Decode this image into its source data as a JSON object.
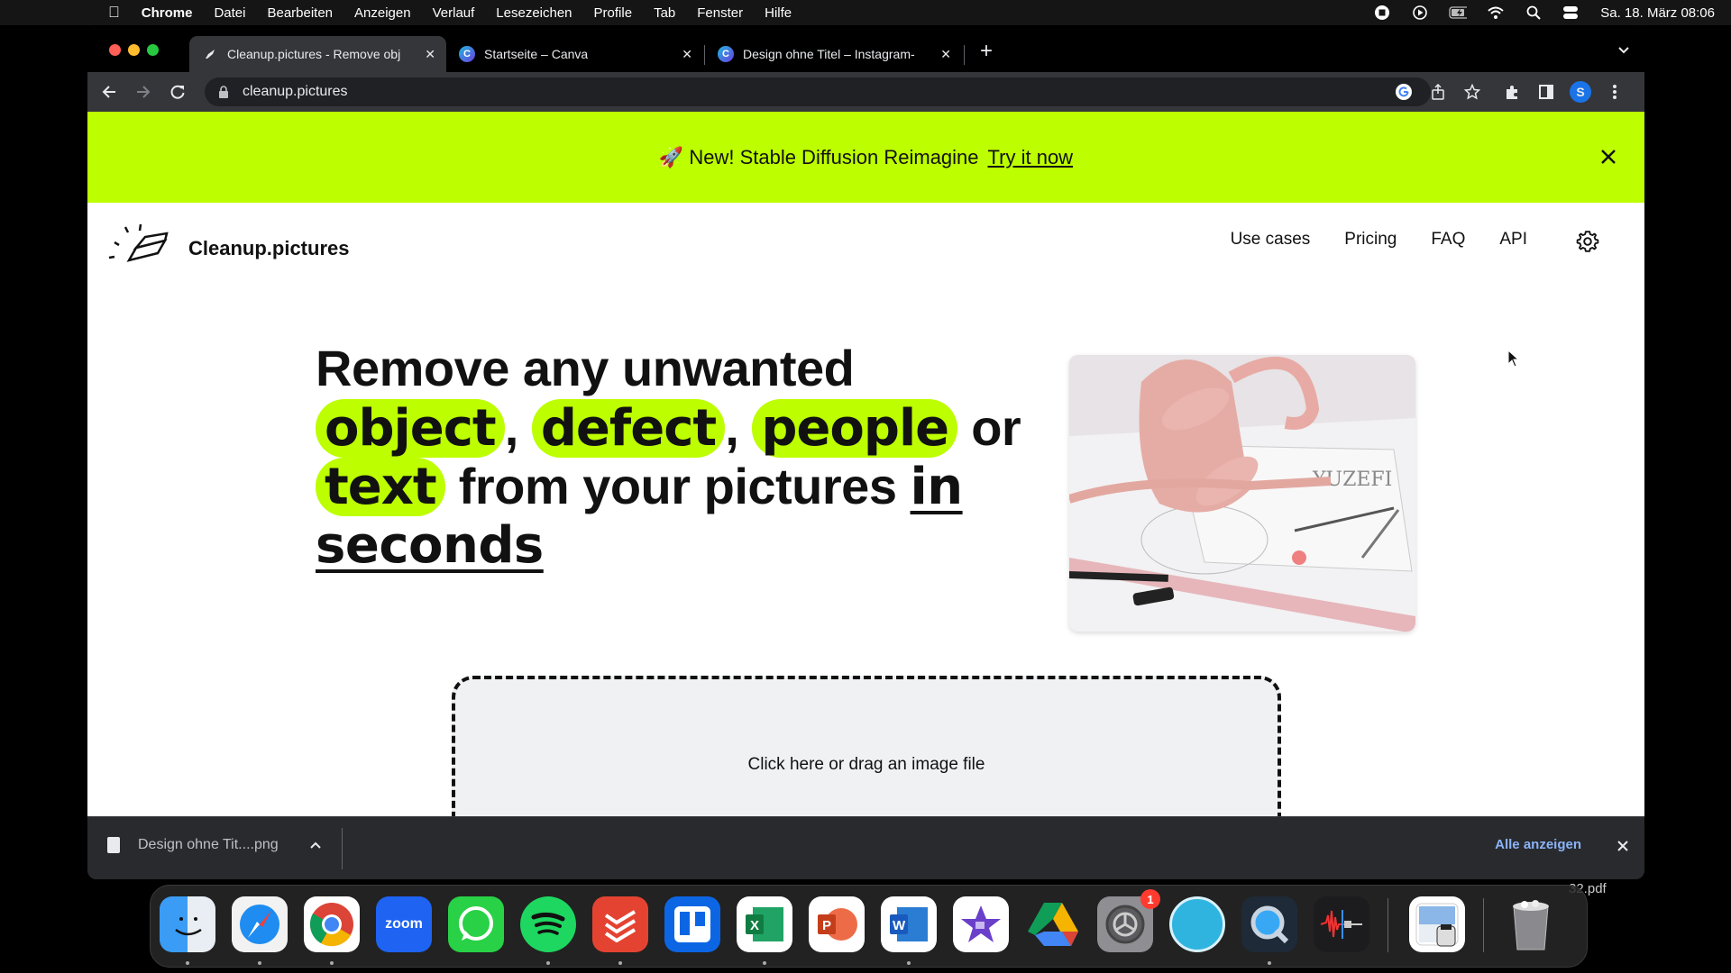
{
  "menubar": {
    "app_name": "Chrome",
    "menus": [
      "Datei",
      "Bearbeiten",
      "Anzeigen",
      "Verlauf",
      "Lesezeichen",
      "Profile",
      "Tab",
      "Fenster",
      "Hilfe"
    ],
    "datetime": "Sa. 18. März  08:06",
    "status_icons": [
      "record-stop-icon",
      "play-icon",
      "battery-charging-icon",
      "wifi-icon",
      "search-icon",
      "control-center-icon"
    ]
  },
  "browser": {
    "tabs": [
      {
        "title": "Cleanup.pictures - Remove obj",
        "favicon": "eraser-icon",
        "active": true
      },
      {
        "title": "Startseite – Canva",
        "favicon": "canva-icon",
        "active": false
      },
      {
        "title": "Design ohne Titel – Instagram-",
        "favicon": "canva-icon",
        "active": false
      }
    ],
    "new_tab_label": "+",
    "url": "cleanup.pictures",
    "profile_initial": "S",
    "colors": {
      "profile": "#1a73e8",
      "tabstrip": "#000000",
      "toolbar": "#35363a"
    }
  },
  "banner": {
    "emoji": "🚀",
    "text": "New! Stable Diffusion Reimagine",
    "link_label": "Try it now",
    "color": "#bdfe00"
  },
  "nav": {
    "brand": "Cleanup.pictures",
    "links": [
      "Use cases",
      "Pricing",
      "FAQ",
      "API"
    ]
  },
  "hero": {
    "line1": "Remove any unwanted",
    "highlight1": "object",
    "highlight2": "defect",
    "highlight3": "people",
    "comma": ",",
    "or": "or",
    "highlight4": "text",
    "mid": "from your pictures",
    "underline1": "in",
    "underline2": "seconds",
    "highlight_color": "#bdfe00"
  },
  "hero_image": {
    "alt": "Pink handbag with ruler, pens and design sketch",
    "paper_text": "YUZEFI"
  },
  "dropzone": {
    "label": "Click here or drag an image file"
  },
  "downloads": {
    "file": "Design ohne Tit....png",
    "show_all": "Alle anzeigen"
  },
  "dock": {
    "apps": [
      {
        "name": "Finder",
        "running": true
      },
      {
        "name": "Safari",
        "running": true
      },
      {
        "name": "Chrome",
        "running": true
      },
      {
        "name": "Zoom",
        "label": "zoom",
        "running": false
      },
      {
        "name": "WhatsApp",
        "running": false
      },
      {
        "name": "Spotify",
        "running": true
      },
      {
        "name": "Todoist",
        "running": true
      },
      {
        "name": "Trello",
        "running": false
      },
      {
        "name": "Excel",
        "label": "X",
        "running": true
      },
      {
        "name": "PowerPoint",
        "label": "P",
        "running": false
      },
      {
        "name": "Word",
        "label": "W",
        "running": true
      },
      {
        "name": "iMovie",
        "running": false
      },
      {
        "name": "Google Drive",
        "running": false
      },
      {
        "name": "System Settings",
        "badge": "1",
        "running": false
      },
      {
        "name": "Mirror",
        "running": false
      },
      {
        "name": "QuickTime",
        "running": true
      },
      {
        "name": "Audio Editor",
        "running": false
      },
      {
        "name": "Preview",
        "running": false
      },
      {
        "name": "Trash",
        "running": false
      }
    ],
    "desktop_file": "32.pdf"
  }
}
